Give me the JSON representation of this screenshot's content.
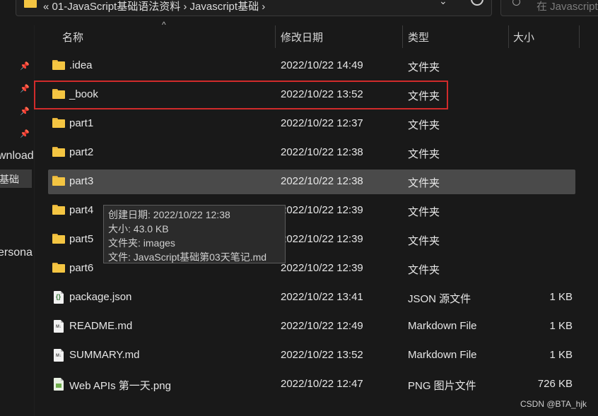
{
  "address": {
    "path_text": "« 01-JavaScript基础语法资料 › Javascript基础 ›",
    "chevron": "⌄",
    "search_placeholder": "在 Javascript..."
  },
  "nav": {
    "partial_items": [
      "wnload",
      "基础",
      "ersona"
    ]
  },
  "columns": {
    "name": "名称",
    "date": "修改日期",
    "type": "类型",
    "size": "大小",
    "sort_indicator": "^"
  },
  "rows": [
    {
      "name": ".idea",
      "date": "2022/10/22 14:49",
      "type": "文件夹",
      "size": "",
      "icon": "folder-icon"
    },
    {
      "name": "_book",
      "date": "2022/10/22 13:52",
      "type": "文件夹",
      "size": "",
      "icon": "folder-icon"
    },
    {
      "name": "part1",
      "date": "2022/10/22 12:37",
      "type": "文件夹",
      "size": "",
      "icon": "folder-icon"
    },
    {
      "name": "part2",
      "date": "2022/10/22 12:38",
      "type": "文件夹",
      "size": "",
      "icon": "folder-icon"
    },
    {
      "name": "part3",
      "date": "2022/10/22 12:38",
      "type": "文件夹",
      "size": "",
      "icon": "folder-icon"
    },
    {
      "name": "part4",
      "date": "2022/10/22 12:39",
      "type": "文件夹",
      "size": "",
      "icon": "folder-icon"
    },
    {
      "name": "part5",
      "date": "2022/10/22 12:39",
      "type": "文件夹",
      "size": "",
      "icon": "folder-icon"
    },
    {
      "name": "part6",
      "date": "2022/10/22 12:39",
      "type": "文件夹",
      "size": "",
      "icon": "folder-icon"
    },
    {
      "name": "package.json",
      "date": "2022/10/22 13:41",
      "type": "JSON 源文件",
      "size": "1 KB",
      "icon": "json-file-icon"
    },
    {
      "name": "README.md",
      "date": "2022/10/22 12:49",
      "type": "Markdown File",
      "size": "1 KB",
      "icon": "markdown-file-icon"
    },
    {
      "name": "SUMMARY.md",
      "date": "2022/10/22 13:52",
      "type": "Markdown File",
      "size": "1 KB",
      "icon": "markdown-file-icon"
    },
    {
      "name": "Web APIs 第一天.png",
      "date": "2022/10/22 12:47",
      "type": "PNG 图片文件",
      "size": "726 KB",
      "icon": "png-file-icon"
    }
  ],
  "tooltip": {
    "created": "创建日期: 2022/10/22 12:38",
    "size": "大小: 43.0 KB",
    "folders": "文件夹: images",
    "files": "文件: JavaScript基础第03天笔记.md"
  },
  "watermark": "CSDN @BTA_hjk",
  "colors": {
    "background": "#191919",
    "hover_row": "#4a4a4a",
    "highlight_box": "#d12b2b",
    "folder": "#f4c542"
  }
}
